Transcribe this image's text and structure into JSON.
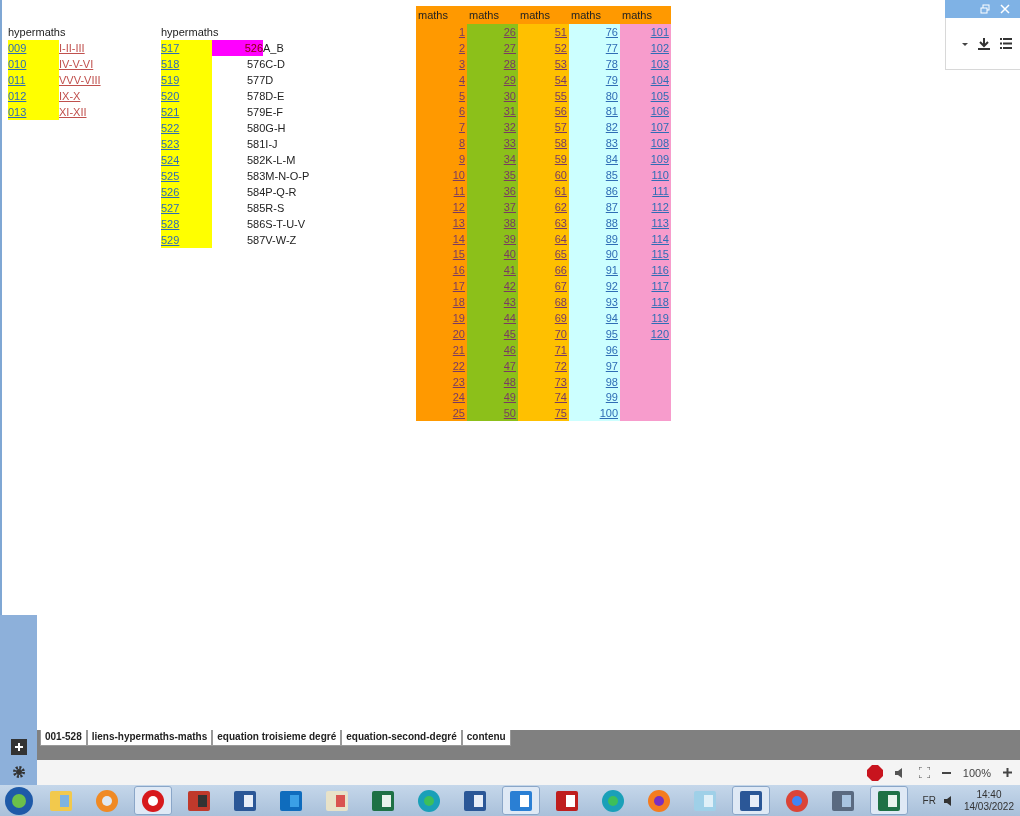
{
  "left_table": {
    "header": "hypermaths",
    "rows": [
      {
        "code": "009",
        "label": "I-II-III"
      },
      {
        "code": "010",
        "label": "IV-V-VI"
      },
      {
        "code": "011",
        "label": "VVV-VIII"
      },
      {
        "code": "012",
        "label": "IX-X"
      },
      {
        "code": "013",
        "label": "XI-XII"
      }
    ]
  },
  "middle_table": {
    "header": "hypermaths",
    "rows": [
      {
        "code": "517",
        "overflow_text": "526",
        "label": "A_B",
        "highlighted": true
      },
      {
        "code": "518",
        "label": "576C-D",
        "highlighted": false
      },
      {
        "code": "519",
        "label": "577D",
        "highlighted": false
      },
      {
        "code": "520",
        "label": "578D-E",
        "highlighted": false
      },
      {
        "code": "521",
        "label": "579E-F",
        "highlighted": false
      },
      {
        "code": "522",
        "label": "580G-H",
        "highlighted": false
      },
      {
        "code": "523",
        "label": "581I-J",
        "highlighted": false
      },
      {
        "code": "524",
        "label": "582K-L-M",
        "highlighted": false
      },
      {
        "code": "525",
        "label": "583M-N-O-P",
        "highlighted": false
      },
      {
        "code": "526",
        "label": "584P-Q-R",
        "highlighted": false
      },
      {
        "code": "527",
        "label": "585R-S",
        "highlighted": false
      },
      {
        "code": "528",
        "label": "586S-T-U-V",
        "highlighted": false
      },
      {
        "code": "529",
        "label": "587V-W-Z",
        "highlighted": false
      }
    ]
  },
  "maths_table": {
    "columns": [
      {
        "header": "maths",
        "color": "#ff9900",
        "visited": true,
        "values": [
          "1",
          "2",
          "3",
          "4",
          "5",
          "6",
          "7",
          "8",
          "9",
          "10",
          "11",
          "12",
          "13",
          "14",
          "15",
          "16",
          "17",
          "18",
          "19",
          "20",
          "21",
          "22",
          "23",
          "24",
          "25"
        ]
      },
      {
        "header": "maths",
        "color": "#8cc01a",
        "visited": true,
        "values": [
          "26",
          "27",
          "28",
          "29",
          "30",
          "31",
          "32",
          "33",
          "34",
          "35",
          "36",
          "37",
          "38",
          "39",
          "40",
          "41",
          "42",
          "43",
          "44",
          "45",
          "46",
          "47",
          "48",
          "49",
          "50"
        ]
      },
      {
        "header": "maths",
        "color": "#ffc000",
        "visited": true,
        "values": [
          "51",
          "52",
          "53",
          "54",
          "55",
          "56",
          "57",
          "58",
          "59",
          "60",
          "61",
          "62",
          "63",
          "64",
          "65",
          "66",
          "67",
          "68",
          "69",
          "70",
          "71",
          "72",
          "73",
          "74",
          "75"
        ]
      },
      {
        "header": "maths",
        "color": "#ccffff",
        "visited": false,
        "values": [
          "76",
          "77",
          "78",
          "79",
          "80",
          "81",
          "82",
          "83",
          "84",
          "85",
          "86",
          "87",
          "88",
          "89",
          "90",
          "91",
          "92",
          "93",
          "94",
          "95",
          "96",
          "97",
          "98",
          "99",
          "100"
        ]
      },
      {
        "header": "maths",
        "color": "#f79ccc",
        "visited": false,
        "values": [
          "101",
          "102",
          "103",
          "104",
          "105",
          "106",
          "107",
          "108",
          "109",
          "110",
          "111",
          "112",
          "113",
          "114",
          "115",
          "116",
          "117",
          "118",
          "119",
          "120"
        ]
      }
    ]
  },
  "sheet_tabs": [
    {
      "label": "001-528"
    },
    {
      "label": "liens-hypermaths-maths"
    },
    {
      "label": "equation troisieme degré"
    },
    {
      "label": "equation-second-degré"
    },
    {
      "label": "contenu"
    }
  ],
  "status_bar": {
    "zoom": "100%"
  },
  "taskbar": {
    "apps": [
      {
        "kind": "folder",
        "active": false
      },
      {
        "kind": "player",
        "active": false
      },
      {
        "kind": "opera",
        "active": true
      },
      {
        "kind": "video",
        "active": false
      },
      {
        "kind": "word",
        "active": false
      },
      {
        "kind": "outlook",
        "active": false
      },
      {
        "kind": "paint",
        "active": false
      },
      {
        "kind": "excel",
        "active": false
      },
      {
        "kind": "edge",
        "active": false
      },
      {
        "kind": "word",
        "active": false
      },
      {
        "kind": "maxthon",
        "active": true
      },
      {
        "kind": "filezilla",
        "active": false
      },
      {
        "kind": "edge",
        "active": false
      },
      {
        "kind": "firefox",
        "active": false
      },
      {
        "kind": "notepad",
        "active": false
      },
      {
        "kind": "word",
        "active": true
      },
      {
        "kind": "chrome",
        "active": false
      },
      {
        "kind": "network",
        "active": false
      },
      {
        "kind": "excel",
        "active": true
      }
    ],
    "language": "FR",
    "time": "14:40",
    "date": "14/03/2022"
  }
}
